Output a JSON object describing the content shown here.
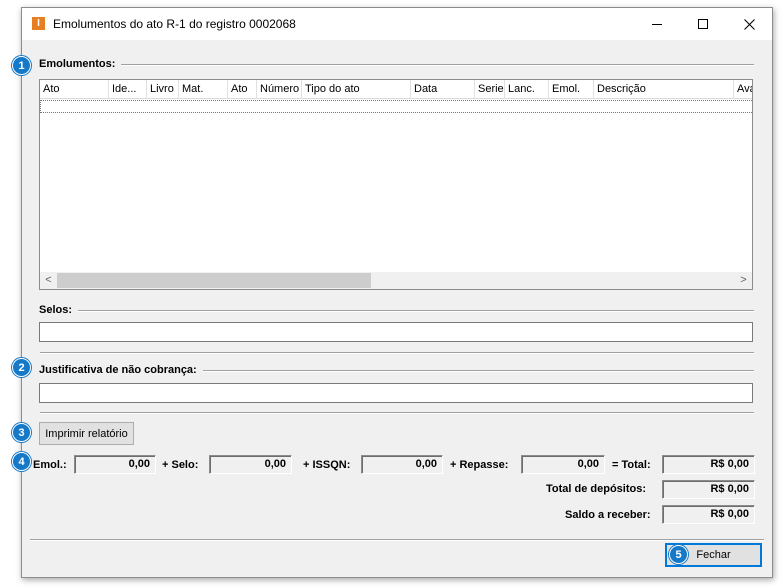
{
  "window": {
    "title": "Emolumentos do ato R-1 do registro 0002068",
    "app_icon_glyph": "I",
    "buttons": [
      "minimize-icon",
      "maximize-icon",
      "close-icon"
    ]
  },
  "emolumentos": {
    "label": "Emolumentos:",
    "columns": [
      "Ato",
      "Ide...",
      "Livro",
      "Mat.",
      "Ato",
      "Número",
      "Tipo do ato",
      "Data",
      "Serie",
      "Lanc.",
      "Emol.",
      "Descrição",
      "Ava"
    ],
    "scroll_left": "<",
    "scroll_right": ">"
  },
  "selos": {
    "label": "Selos:",
    "value": ""
  },
  "justificativa": {
    "label": "Justificativa de não cobrança:",
    "value": ""
  },
  "actions": {
    "print_label": "Imprimir relatório",
    "close_label": "Fechar"
  },
  "totals": {
    "emol_label": "Emol.:",
    "emol_value": "0,00",
    "selo_label": "+ Selo:",
    "selo_value": "0,00",
    "issqn_label": "+ ISSQN:",
    "issqn_value": "0,00",
    "repasse_label": "+ Repasse:",
    "repasse_value": "0,00",
    "total_label": "= Total:",
    "total_value": "R$ 0,00",
    "depositos_label": "Total de depósitos:",
    "depositos_value": "R$ 0,00",
    "saldo_label": "Saldo a receber:",
    "saldo_value": "R$ 0,00"
  },
  "badges": [
    "1",
    "2",
    "3",
    "4",
    "5"
  ],
  "colors": {
    "badge": "#1679c8",
    "app_icon": "#e67e22",
    "default_button_border": "#0078d7"
  }
}
